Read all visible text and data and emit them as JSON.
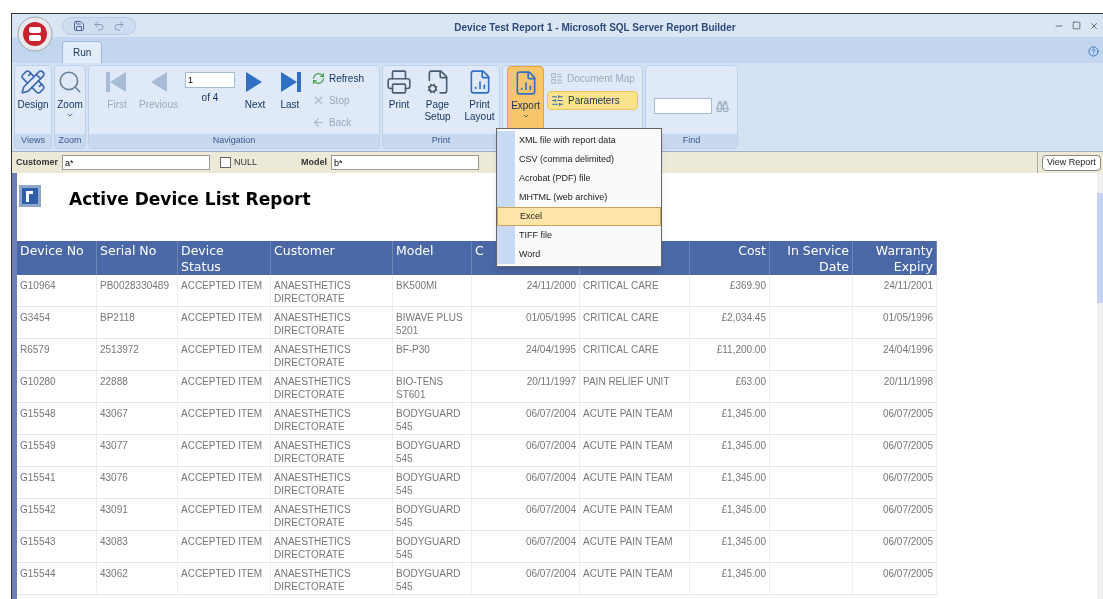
{
  "window": {
    "title": "Device Test Report 1 - Microsoft SQL Server Report Builder"
  },
  "tabs": [
    {
      "label": "Run",
      "selected": true
    }
  ],
  "ribbon": {
    "groups": [
      {
        "label": "Views",
        "items": [
          {
            "kind": "large",
            "label": "Design",
            "disabled": false
          }
        ]
      },
      {
        "label": "Zoom",
        "items": [
          {
            "kind": "large",
            "label": "Zoom",
            "disabled": false,
            "dropdown": true
          }
        ]
      },
      {
        "label": "Navigation",
        "items": [
          {
            "kind": "large",
            "label": "First",
            "disabled": true
          },
          {
            "kind": "large",
            "label": "Previous",
            "disabled": true
          },
          {
            "kind": "page",
            "value": "1",
            "of": "of 4"
          },
          {
            "kind": "large",
            "label": "Next",
            "disabled": false
          },
          {
            "kind": "large",
            "label": "Last",
            "disabled": false
          },
          {
            "kind": "stack",
            "items": [
              {
                "label": "Refresh",
                "disabled": false,
                "highlighted": false
              },
              {
                "label": "Stop",
                "disabled": true,
                "highlighted": false
              },
              {
                "label": "Back",
                "disabled": true,
                "highlighted": false
              }
            ]
          }
        ]
      },
      {
        "label": "Print",
        "items": [
          {
            "kind": "large",
            "label": "Print",
            "disabled": false
          },
          {
            "kind": "large",
            "label": "Page Setup",
            "disabled": false
          },
          {
            "kind": "large",
            "label": "Print Layout",
            "disabled": false
          }
        ]
      },
      {
        "items": [
          {
            "kind": "large",
            "label": "Export",
            "disabled": false,
            "dropdown": true,
            "highlighted": true
          },
          {
            "kind": "stack",
            "items": [
              {
                "label": "Document Map",
                "disabled": true,
                "highlighted": false
              },
              {
                "label": "Parameters",
                "disabled": false,
                "highlighted": true
              }
            ]
          }
        ]
      },
      {
        "label": "Find",
        "items": [
          {
            "kind": "search"
          }
        ]
      }
    ]
  },
  "parameters": [
    {
      "kind": "text",
      "label": "Customer",
      "value": "a*"
    },
    {
      "kind": "checkbox",
      "label": "NULL",
      "checked": false
    },
    {
      "kind": "text",
      "label": "Model",
      "value": "b*"
    }
  ],
  "view_report_button": "View Report",
  "export_menu": {
    "items": [
      {
        "label": "XML file with report data",
        "selected": false
      },
      {
        "label": "CSV (comma delimited)",
        "selected": false
      },
      {
        "label": "Acrobat (PDF) file",
        "selected": false
      },
      {
        "label": "MHTML (web archive)",
        "selected": false
      },
      {
        "label": "Excel",
        "selected": true
      },
      {
        "label": "TIFF file",
        "selected": false
      },
      {
        "label": "Word",
        "selected": false
      }
    ]
  },
  "report": {
    "title": "Active Device List Report",
    "columns": [
      {
        "label": "Device No"
      },
      {
        "label": "Serial No"
      },
      {
        "label": "Device Status"
      },
      {
        "label": "Customer"
      },
      {
        "label": "Model"
      },
      {
        "label": "C"
      },
      {},
      {
        "label": "Cost"
      },
      {
        "label": "In Service Date"
      },
      {
        "label": "Warranty Expiry"
      }
    ],
    "rows": [
      [
        "G10964",
        "PB0028330489",
        "ACCEPTED ITEM",
        "ANAESTHETICS DIRECTORATE",
        "BK500MI",
        "24/11/2000",
        "CRITICAL CARE",
        "£369.90",
        null,
        "24/11/2001"
      ],
      [
        "G3454",
        "BP2118",
        "ACCEPTED ITEM",
        "ANAESTHETICS DIRECTORATE",
        "BIWAVE PLUS 5201",
        "01/05/1995",
        "CRITICAL CARE",
        "£2,034.45",
        null,
        "01/05/1996"
      ],
      [
        "R6579",
        "2513972",
        "ACCEPTED ITEM",
        "ANAESTHETICS DIRECTORATE",
        "BF-P30",
        "24/04/1995",
        "CRITICAL CARE",
        "£11,200.00",
        null,
        "24/04/1996"
      ],
      [
        "G10280",
        "22888",
        "ACCEPTED ITEM",
        "ANAESTHETICS DIRECTORATE",
        "BIO-TENS ST601",
        "20/11/1997",
        "PAIN RELIEF UNIT",
        "£63.00",
        null,
        "20/11/1998"
      ],
      [
        "G15548",
        "43067",
        "ACCEPTED ITEM",
        "ANAESTHETICS DIRECTORATE",
        "BODYGUARD 545",
        "06/07/2004",
        "ACUTE PAIN TEAM",
        "£1,345.00",
        null,
        "06/07/2005"
      ],
      [
        "G15549",
        "43077",
        "ACCEPTED ITEM",
        "ANAESTHETICS DIRECTORATE",
        "BODYGUARD 545",
        "06/07/2004",
        "ACUTE PAIN TEAM",
        "£1,345.00",
        null,
        "06/07/2005"
      ],
      [
        "G15541",
        "43076",
        "ACCEPTED ITEM",
        "ANAESTHETICS DIRECTORATE",
        "BODYGUARD 545",
        "06/07/2004",
        "ACUTE PAIN TEAM",
        "£1,345.00",
        null,
        "06/07/2005"
      ],
      [
        "G15542",
        "43091",
        "ACCEPTED ITEM",
        "ANAESTHETICS DIRECTORATE",
        "BODYGUARD 545",
        "06/07/2004",
        "ACUTE PAIN TEAM",
        "£1,345.00",
        null,
        "06/07/2005"
      ],
      [
        "G15543",
        "43083",
        "ACCEPTED ITEM",
        "ANAESTHETICS DIRECTORATE",
        "BODYGUARD 545",
        "06/07/2004",
        "ACUTE PAIN TEAM",
        "£1,345.00",
        null,
        "06/07/2005"
      ],
      [
        "G15544",
        "43062",
        "ACCEPTED ITEM",
        "ANAESTHETICS DIRECTORATE",
        "BODYGUARD 545",
        "06/07/2004",
        "ACUTE PAIN TEAM",
        "£1,345.00",
        null,
        "06/07/2005"
      ]
    ]
  }
}
